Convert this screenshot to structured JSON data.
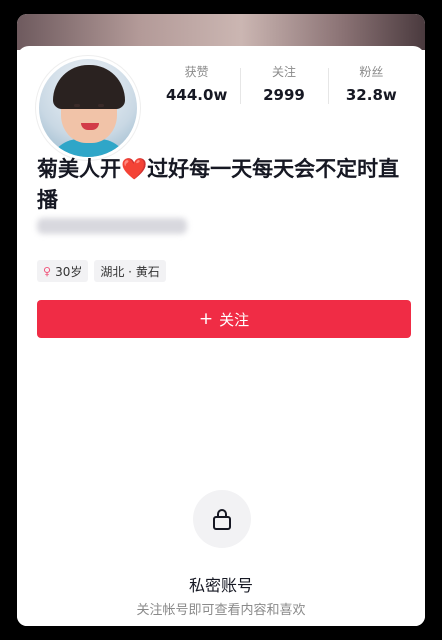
{
  "profile": {
    "nickname": "菊美人开❤️过好每一天每天会不定时直播",
    "stats": [
      {
        "label": "获赞",
        "value": "444.0w"
      },
      {
        "label": "关注",
        "value": "2999"
      },
      {
        "label": "粉丝",
        "value": "32.8w"
      }
    ],
    "tags": {
      "age": "30岁",
      "location": "湖北 · 黄石"
    },
    "follow_button_label": "关注"
  },
  "private": {
    "title": "私密账号",
    "subtitle": "关注帐号即可查看内容和喜欢"
  },
  "icons": {
    "lock": "lock-icon",
    "gender": "female-icon",
    "follow": "plus-icon"
  },
  "colors": {
    "accent": "#f02c45",
    "gender": "#f0547a"
  }
}
